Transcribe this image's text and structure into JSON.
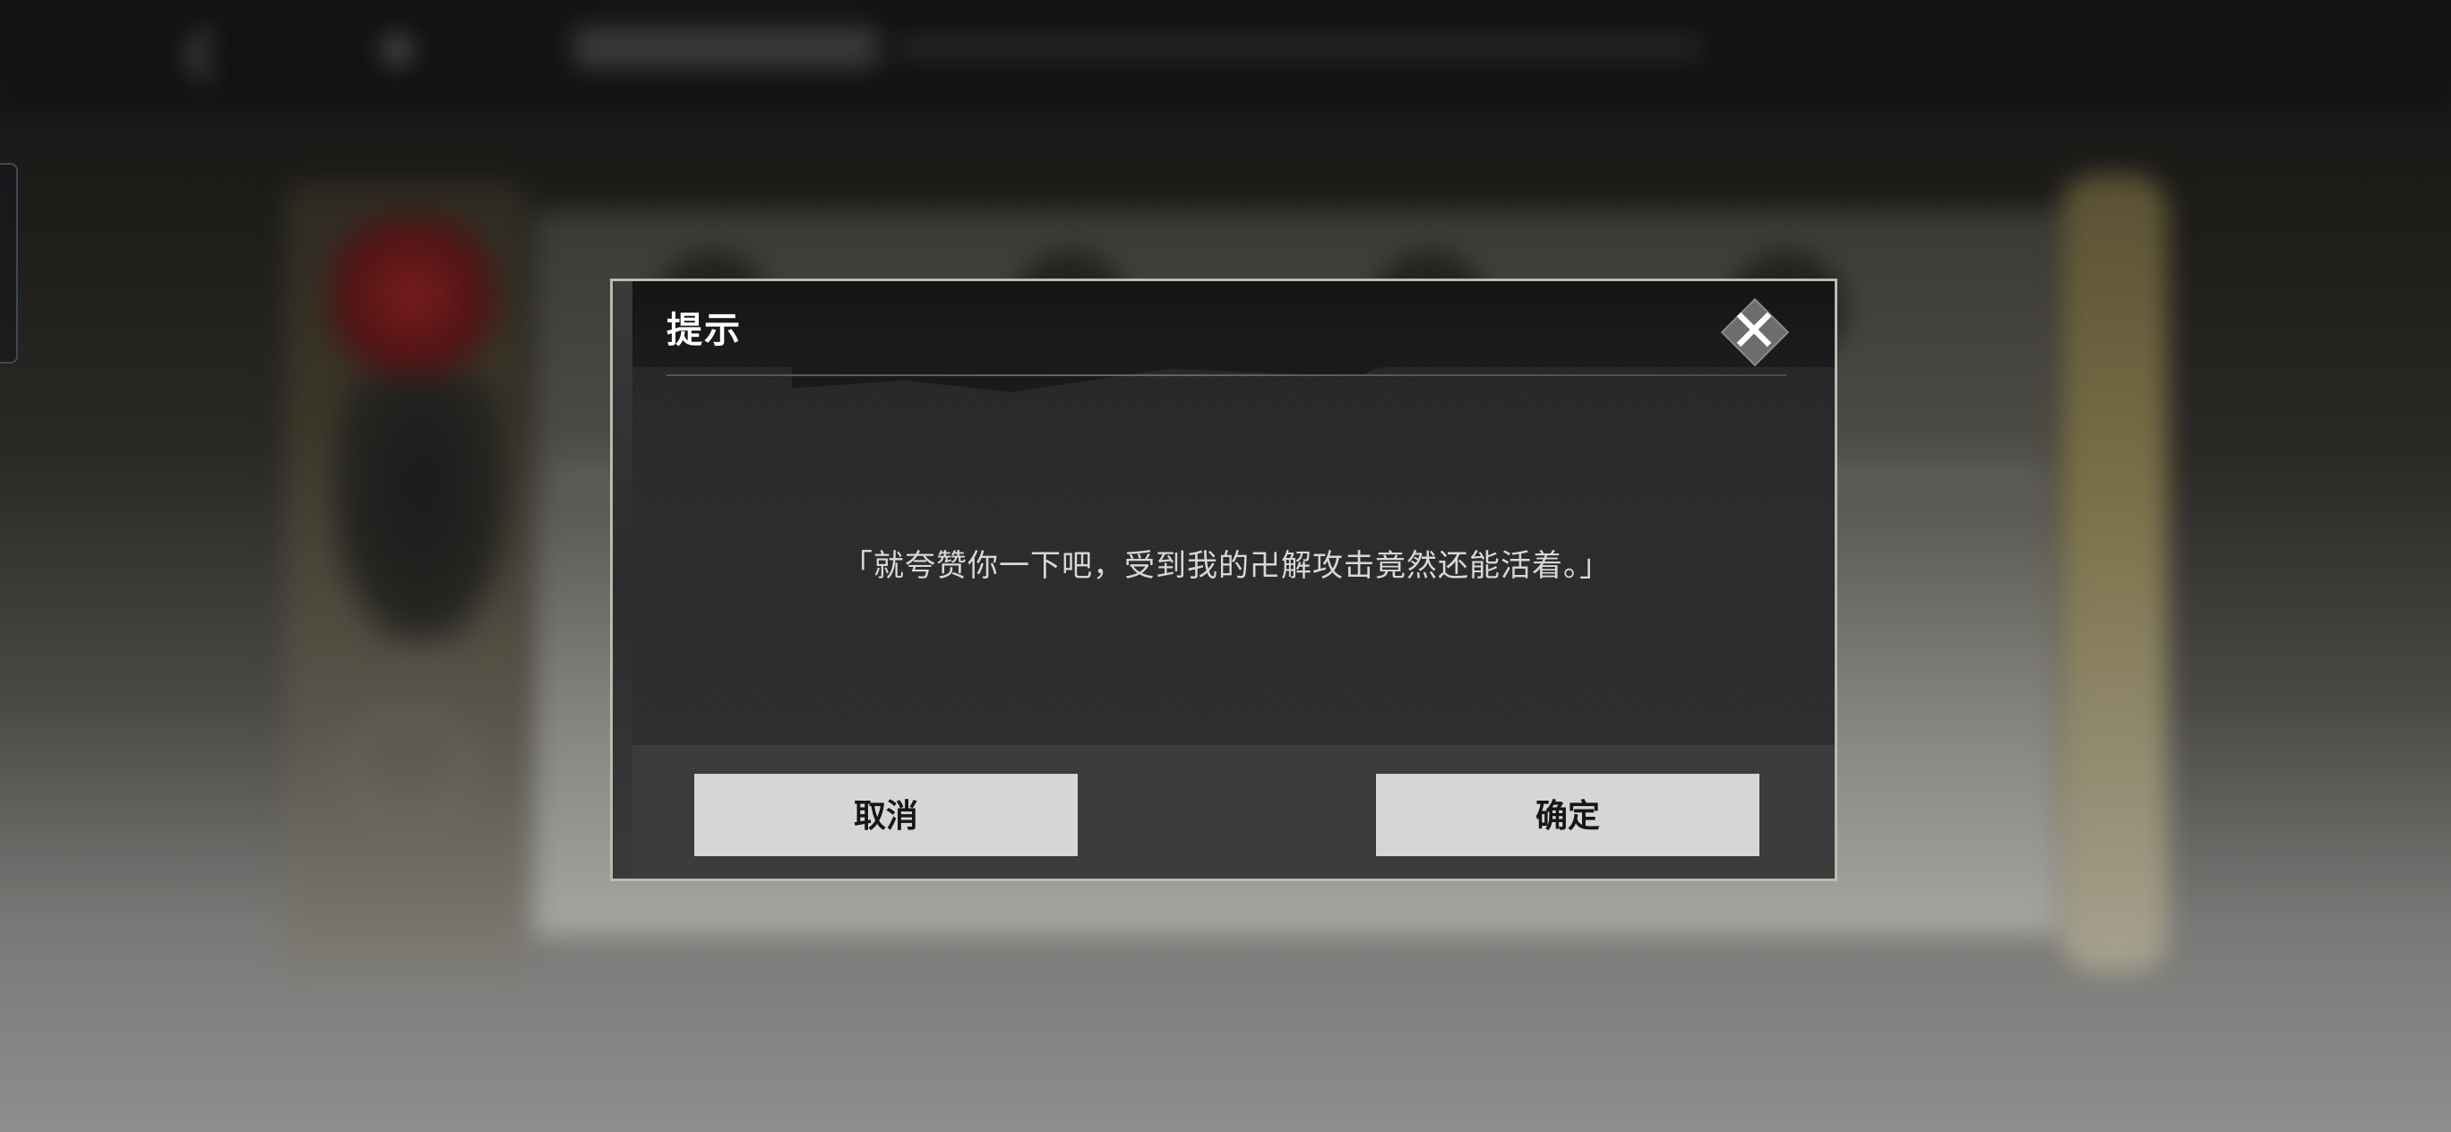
{
  "dialog": {
    "title": "提示",
    "message": "「就夸赞你一下吧，受到我的卍解攻击竟然还能活着。」",
    "cancel_label": "取消",
    "confirm_label": "确定",
    "close_icon": "close-icon"
  },
  "background": {
    "blurred": true,
    "back_icon": "share-back-icon",
    "settings_icon": "plus-icon"
  },
  "colors": {
    "dialog_border": "#bdbab2",
    "dialog_body": "#2a2a2a",
    "dialog_header": "#151515",
    "button_bg": "#d6d6d6",
    "button_text": "#161616",
    "title_text": "#ffffff",
    "message_text": "#d8d8d8"
  }
}
